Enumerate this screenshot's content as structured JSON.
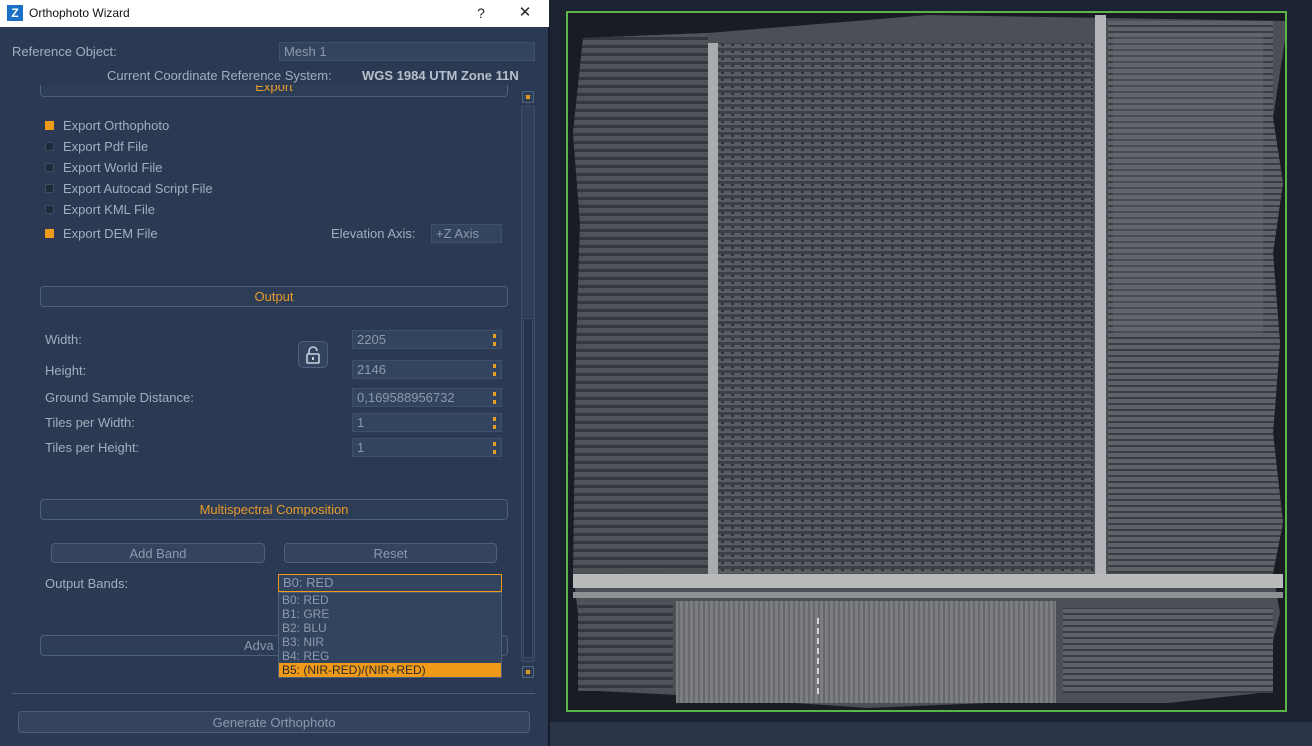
{
  "window": {
    "title": "Orthophoto Wizard",
    "icon_letter": "Z",
    "help_glyph": "?",
    "close_glyph": "✕"
  },
  "reference": {
    "label": "Reference Object:",
    "value": "Mesh 1",
    "crs_label": "Current Coordinate Reference System:",
    "crs_value": "WGS 1984 UTM Zone 11N"
  },
  "export": {
    "header": "Export",
    "options": [
      {
        "label": "Export Orthophoto",
        "checked": true
      },
      {
        "label": "Export Pdf File",
        "checked": false
      },
      {
        "label": "Export World File",
        "checked": false
      },
      {
        "label": "Export Autocad Script File",
        "checked": false
      },
      {
        "label": "Export KML File",
        "checked": false
      },
      {
        "label": "Export DEM File",
        "checked": true
      }
    ],
    "elevation_axis_label": "Elevation Axis:",
    "elevation_axis_value": "+Z Axis"
  },
  "output": {
    "header": "Output",
    "fields": [
      {
        "label": "Width:",
        "value": "2205"
      },
      {
        "label": "Height:",
        "value": "2146"
      },
      {
        "label": "Ground Sample Distance:",
        "value": "0,169588956732"
      },
      {
        "label": "Tiles per Width:",
        "value": "1"
      },
      {
        "label": "Tiles per Height:",
        "value": "1"
      }
    ]
  },
  "multispectral": {
    "header": "Multispectral Composition",
    "add_band_label": "Add Band",
    "reset_label": "Reset",
    "output_bands_label": "Output Bands:",
    "selected_band": "B0: RED",
    "band_options": [
      "B0: RED",
      "B1: GRE",
      "B2: BLU",
      "B3: NIR",
      "B4: REG",
      "B5: (NIR-RED)/(NIR+RED)"
    ],
    "highlighted_index": 5
  },
  "advanced": {
    "header_visible": "Adva"
  },
  "generate_label": "Generate Orthophoto",
  "colors": {
    "accent": "#f09a1a",
    "panel": "#2b3a52",
    "frame": "#5cb548"
  }
}
